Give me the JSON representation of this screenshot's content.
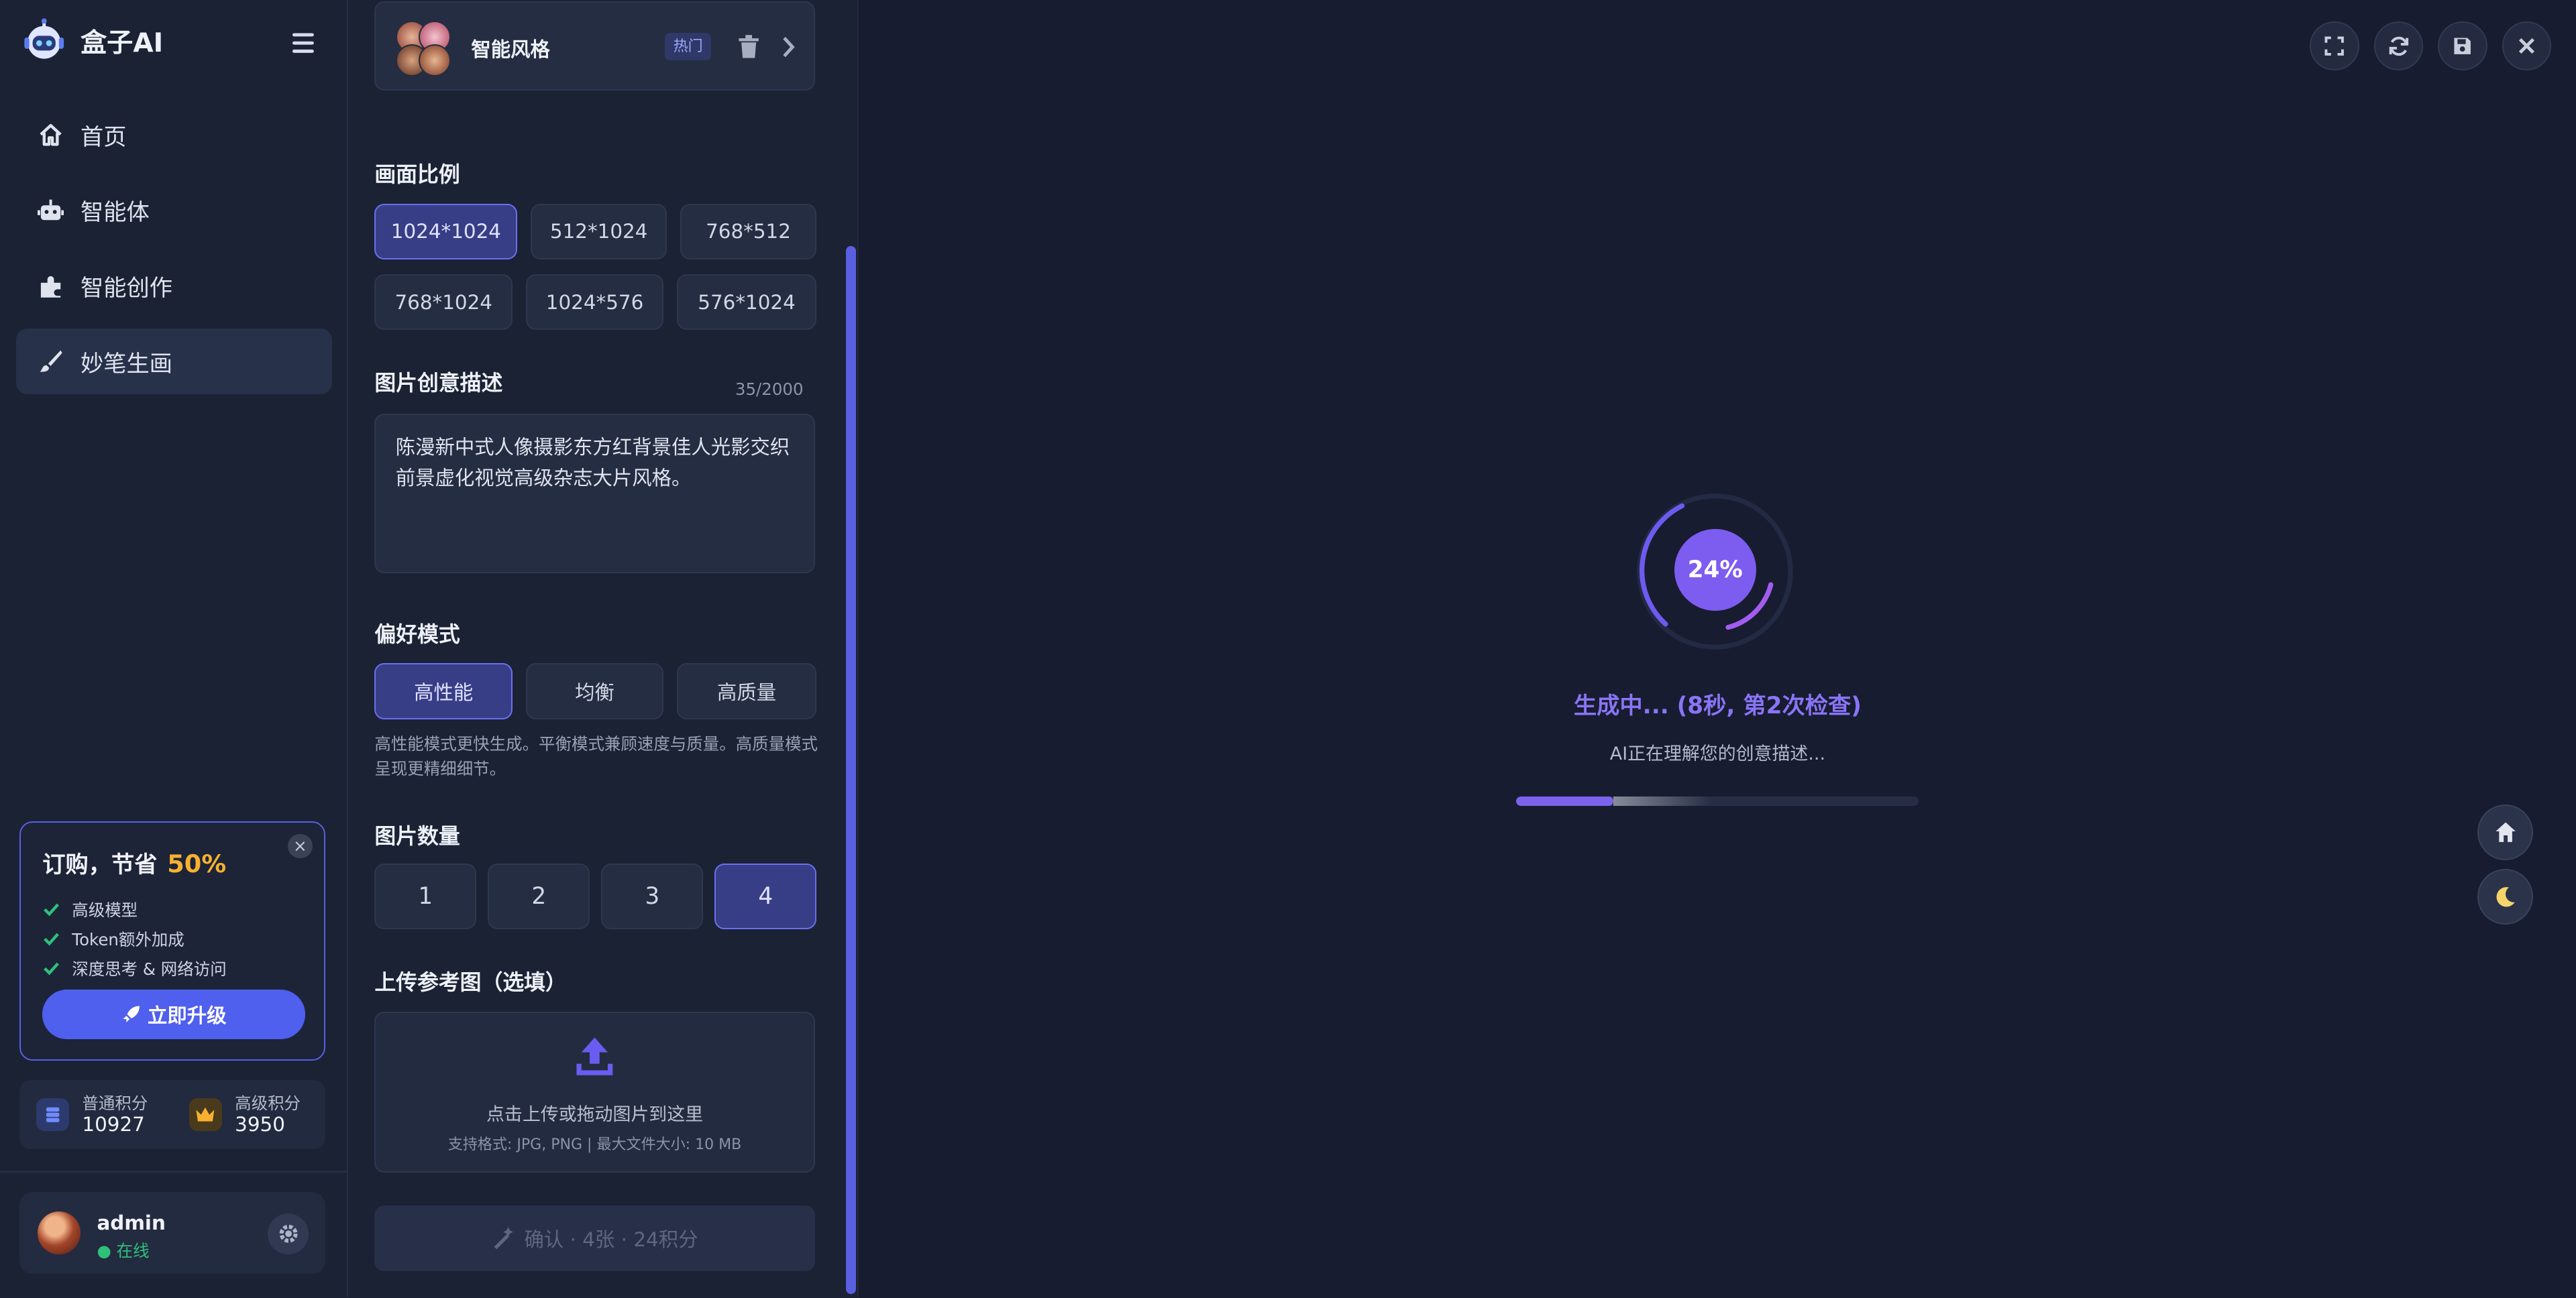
{
  "app": {
    "name": "盒子AI"
  },
  "nav": {
    "items": [
      {
        "label": "首页",
        "icon": "home-icon"
      },
      {
        "label": "智能体",
        "icon": "robot-icon"
      },
      {
        "label": "智能创作",
        "icon": "puzzle-icon"
      },
      {
        "label": "妙笔生画",
        "icon": "brush-icon",
        "active": true
      }
    ]
  },
  "promo": {
    "title": "订购，节省",
    "percent": "50%",
    "features": [
      "高级模型",
      "Token额外加成",
      "深度思考 & 网络访问"
    ],
    "cta": "立即升级",
    "close": "×"
  },
  "points": {
    "normal": {
      "label": "普通积分",
      "value": "10927"
    },
    "premium": {
      "label": "高级积分",
      "value": "3950"
    }
  },
  "user": {
    "name": "admin",
    "status": "● 在线"
  },
  "form": {
    "style": {
      "name": "智能风格",
      "badge": "热门"
    },
    "ratio": {
      "label": "画面比例",
      "options": [
        "1024*1024",
        "512*1024",
        "768*512",
        "768*1024",
        "1024*576",
        "576*1024"
      ],
      "selected": "1024*1024"
    },
    "description": {
      "label": "图片创意描述",
      "counter": "35/2000",
      "value": "陈漫新中式人像摄影东方红背景佳人光影交织前景虚化视觉高级杂志大片风格。"
    },
    "mode": {
      "label": "偏好模式",
      "options": [
        "高性能",
        "均衡",
        "高质量"
      ],
      "selected": "高性能",
      "hint": "高性能模式更快生成。平衡模式兼顾速度与质量。高质量模式呈现更精细细节。"
    },
    "count": {
      "label": "图片数量",
      "options": [
        "1",
        "2",
        "3",
        "4"
      ],
      "selected": "4"
    },
    "upload": {
      "label": "上传参考图（选填）",
      "text": "点击上传或拖动图片到这里",
      "sub": "支持格式: JPG, PNG | 最大文件大小: 10 MB"
    },
    "confirm": "确认 · 4张 · 24积分"
  },
  "generation": {
    "percent_label": "24%",
    "progress": 0.24,
    "title": "生成中... (8秒, 第2次检查)",
    "subtitle": "AI正在理解您的创意描述..."
  },
  "colors": {
    "accent": "#5b5ee6",
    "progress": "#7c63ee",
    "promo_highlight": "#f7b12f",
    "online": "#2fc07a"
  }
}
